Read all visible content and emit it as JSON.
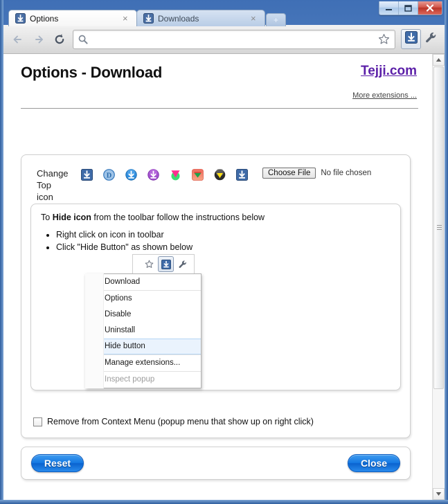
{
  "window": {
    "buttons": [
      {
        "name": "minimize",
        "glyph": "–"
      },
      {
        "name": "maximize",
        "glyph": "□"
      },
      {
        "name": "close",
        "glyph": "✕"
      }
    ]
  },
  "tabs": [
    {
      "label": "Options",
      "favicon": "download-arrow-icon",
      "close": "×",
      "active": true
    },
    {
      "label": "Downloads",
      "favicon": "download-arrow-icon",
      "close": "×",
      "active": false
    }
  ],
  "newtab": {
    "label": "+"
  },
  "toolbar": {
    "back": "←",
    "forward": "→",
    "reload": "↻",
    "omnibox_value": "",
    "omnibox_placeholder": "",
    "star": "☆",
    "extension": "download-arrow-icon",
    "menu": "wrench-icon"
  },
  "page": {
    "title": "Options - Download",
    "brand": "Tejji.com",
    "more_extensions": "More extensions ...",
    "brand_color": "#5b1fa8"
  },
  "icon_chooser": {
    "label": "Change Top icon",
    "label_lines": [
      "Change",
      "Top",
      "icon"
    ],
    "icons": [
      {
        "name": "icon-blue-square-arrow",
        "style": "blue-square"
      },
      {
        "name": "icon-blue-circle-d",
        "style": "blue-circle-d"
      },
      {
        "name": "icon-blue-circle-arrow",
        "style": "blue-circle"
      },
      {
        "name": "icon-purple-circle-arrow",
        "style": "purple-circle"
      },
      {
        "name": "icon-pink-green-chevron",
        "style": "pink-green"
      },
      {
        "name": "icon-red-square-chevron",
        "style": "red-square"
      },
      {
        "name": "icon-yellow-dark-circle",
        "style": "yellow-dark"
      },
      {
        "name": "icon-blue-square-arrow-2",
        "style": "blue-square"
      }
    ],
    "choose_file_label": "Choose File",
    "no_file_text": "No file chosen"
  },
  "hide_section": {
    "intro_prefix": "To ",
    "intro_bold": "Hide icon",
    "intro_suffix": " from the toolbar follow the instructions below",
    "steps": [
      "Right click on icon in toolbar",
      "Click \"Hide Button\" as shown below"
    ],
    "mock_toolbar": {
      "star": "☆",
      "extension": "download-arrow-icon",
      "wrench": "wrench-icon"
    },
    "menu_items": [
      {
        "label": "Download",
        "state": "normal",
        "separator": false
      },
      {
        "label": "Options",
        "state": "normal",
        "separator": true
      },
      {
        "label": "Disable",
        "state": "normal",
        "separator": false
      },
      {
        "label": "Uninstall",
        "state": "normal",
        "separator": false
      },
      {
        "label": "Hide button",
        "state": "highlight",
        "separator": false
      },
      {
        "label": "Manage extensions...",
        "state": "normal",
        "separator": true
      },
      {
        "label": "Inspect popup",
        "state": "disabled",
        "separator": true
      }
    ]
  },
  "context_menu_option": {
    "label": "Remove from Context Menu (popup menu that show up on right click)",
    "checked": false
  },
  "footer": {
    "reset_label": "Reset",
    "close_label": "Close"
  },
  "scrollbar": {
    "up_arrow": "▲",
    "down_arrow": "▼"
  }
}
